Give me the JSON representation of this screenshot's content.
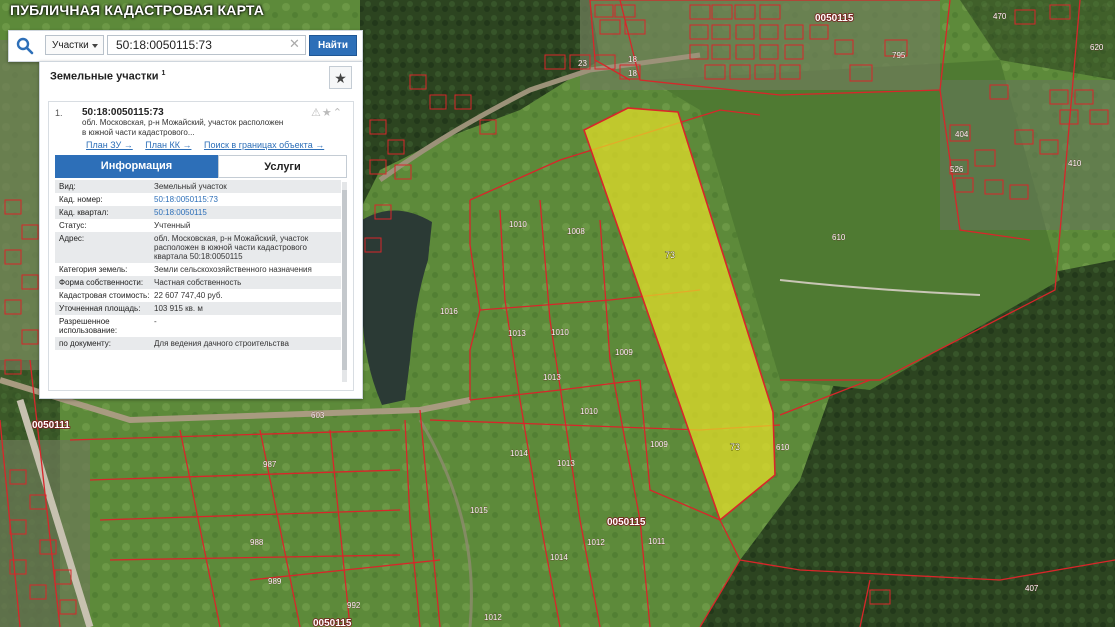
{
  "app": {
    "title": "ПУБЛИЧНАЯ КАДАСТРОВАЯ КАРТА"
  },
  "search": {
    "type_label": "Участки",
    "query": "50:18:0050115:73",
    "button_label": "Найти"
  },
  "panel": {
    "header": "Земельные участки",
    "count": "1",
    "result": {
      "number": "1.",
      "title": "50:18:0050115:73",
      "address_short": "обл. Московская, р-н Можайский, участок расположен в южной части кадастрового...",
      "links": [
        "План ЗУ →",
        "План КК →",
        "Поиск в границах объекта →"
      ]
    },
    "tabs": [
      "Информация",
      "Услуги"
    ],
    "properties": [
      {
        "k": "Вид:",
        "v": "Земельный участок"
      },
      {
        "k": "Кад. номер:",
        "v": "50:18:0050115:73",
        "link": true
      },
      {
        "k": "Кад. квартал:",
        "v": "50:18:0050115",
        "link": true
      },
      {
        "k": "Статус:",
        "v": "Учтенный"
      },
      {
        "k": "Адрес:",
        "v": "обл. Московская, р-н Можайский, участок расположен в южной части кадастрового квартала 50:18:0050115"
      },
      {
        "k": "Категория земель:",
        "v": "Земли сельскохозяйственного назначения"
      },
      {
        "k": "Форма собственности:",
        "v": "Частная собственность"
      },
      {
        "k": "Кадастровая стоимость:",
        "v": "22 607 747,40 руб."
      },
      {
        "k": "Уточненная площадь:",
        "v": "103 915 кв. м"
      },
      {
        "k": "Разрешенное использование:",
        "v": "-"
      },
      {
        "k": "по документу:",
        "v": "Для ведения дачного строительства"
      }
    ]
  },
  "map": {
    "highlight_color": "#e6e028",
    "boundary_color": "#d8262a",
    "quarters": [
      "0050115",
      "0050115",
      "0050111",
      "0050115"
    ],
    "highlight_labels": [
      "73",
      "73"
    ],
    "parcels": [
      "1008",
      "1010",
      "1016",
      "1013",
      "1010",
      "1013",
      "1009",
      "1010",
      "1009",
      "1014",
      "1013",
      "1015",
      "1014",
      "1012",
      "1011",
      "610",
      "610",
      "603",
      "987",
      "988",
      "989",
      "992",
      "1012",
      "407",
      "470",
      "795",
      "404",
      "526",
      "410",
      "620",
      "18",
      "18",
      "23"
    ]
  },
  "colors": {
    "accent": "#2d6fb8",
    "tab_active": "#2d6fb8"
  }
}
